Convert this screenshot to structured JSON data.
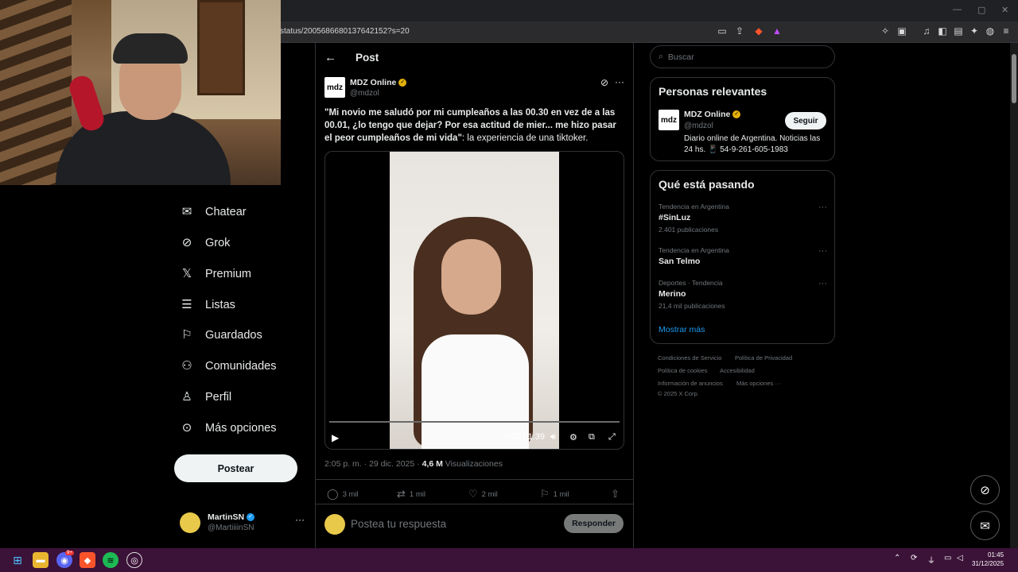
{
  "browser": {
    "url": "status/2005686680137642152?s=20",
    "window_controls": [
      "—",
      "▢",
      "✕"
    ]
  },
  "nav": {
    "items": [
      {
        "label": "Chatear",
        "icon": "mail-icon"
      },
      {
        "label": "Grok",
        "icon": "grok-icon"
      },
      {
        "label": "Premium",
        "icon": "x-logo-icon"
      },
      {
        "label": "Listas",
        "icon": "list-icon"
      },
      {
        "label": "Guardados",
        "icon": "bookmark-icon"
      },
      {
        "label": "Comunidades",
        "icon": "communities-icon"
      },
      {
        "label": "Perfil",
        "icon": "profile-icon"
      },
      {
        "label": "Más opciones",
        "icon": "more-circle-icon"
      }
    ],
    "post_button": "Postear",
    "account": {
      "name": "MartinSN",
      "handle": "@MartiiiinSN"
    }
  },
  "post": {
    "header_title": "Post",
    "author": {
      "name": "MDZ Online",
      "handle": "@mdzol",
      "logo_text": "mdz"
    },
    "text_bold": "\"Mi novio me saludó por mi cumpleaños a las 00.30 en vez de a las 00.01, ¿lo tengo que dejar? Por esa actitud de mier... me hizo pasar el peor cumpleaños de mi vida\"",
    "text_rest": ": la experiencia de una tiktoker.",
    "video": {
      "time": "0:00 / 1:39",
      "progress": 0.0
    },
    "meta": {
      "timestamp": "2:05 p. m. · 29 dic. 2025 · ",
      "views": "4,6 M",
      "views_label": " Visualizaciones"
    },
    "actions": {
      "replies": "3 mil",
      "reposts": "1 mil",
      "likes": "2 mil",
      "bookmarks": "1 mil"
    },
    "reply_placeholder": "Postea tu respuesta",
    "reply_button": "Responder"
  },
  "sidebar": {
    "search_placeholder": "Buscar",
    "relevant": {
      "title": "Personas relevantes",
      "name": "MDZ Online",
      "handle": "@mdzol",
      "logo_text": "mdz",
      "bio": "Diario online de Argentina. Noticias las 24 hs. 📱 54-9-261-605-1983",
      "follow": "Seguir"
    },
    "trending": {
      "title": "Qué está pasando",
      "items": [
        {
          "context": "Tendencia en Argentina",
          "name": "#SinLuz",
          "count": "2.401 publicaciones"
        },
        {
          "context": "Tendencia en Argentina",
          "name": "San Telmo",
          "count": ""
        },
        {
          "context": "Deportes · Tendencia",
          "name": "Merino",
          "count": "21,4 mil publicaciones"
        }
      ],
      "show_more": "Mostrar más"
    },
    "footer": {
      "links": [
        "Condiciones de Servicio",
        "Política de Privacidad",
        "Política de cookies",
        "Accesibilidad",
        "Información de anuncios",
        "Más opciones ···"
      ],
      "copyright": "© 2025 X Corp."
    }
  },
  "taskbar": {
    "time": "01:45",
    "date": "31/12/2025",
    "discord_badge": "9+"
  },
  "colors": {
    "accent": "#1d9bf0",
    "gold_verified": "#e3b10c",
    "taskbar": "#3b1238"
  }
}
